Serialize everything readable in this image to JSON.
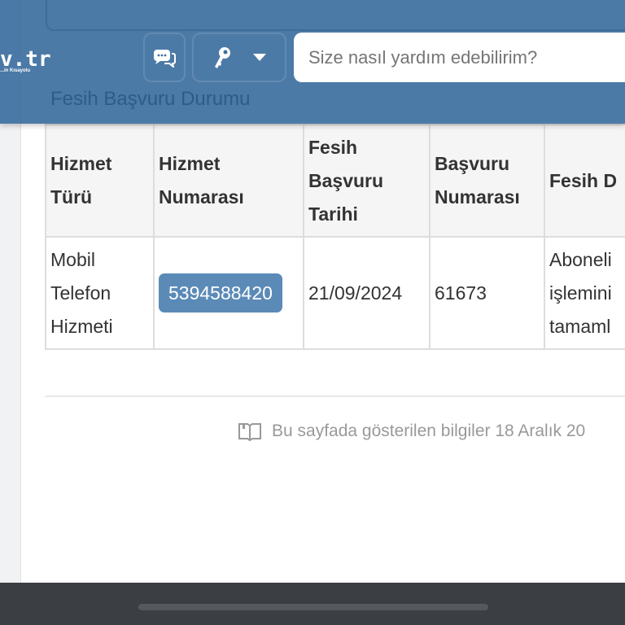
{
  "header": {
    "logo_text": "v.tr",
    "logo_tagline": "...in Kısayolu",
    "search_placeholder": "Size nasıl yardım edebilirim?",
    "icons": [
      "chat-icon",
      "key-icon",
      "caret-down-icon"
    ]
  },
  "page": {
    "title": "Fesih Başvuru Durumu"
  },
  "table": {
    "headers": [
      "Hizmet Türü",
      "Hizmet Numarası",
      "Fesih Başvuru Tarihi",
      "Başvuru Numarası",
      "Fesih D"
    ],
    "rows": [
      {
        "service_type": "Mobil Telefon Hizmeti",
        "service_number": "5394588420",
        "date": "21/09/2024",
        "application_number": "61673",
        "status": "Aboneli işlemini tamaml"
      }
    ]
  },
  "footer_note": "Bu sayfada gösterilen bilgiler 18 Aralık 20",
  "colors": {
    "header": "#3e70a0",
    "button": "#5b8ab7"
  }
}
